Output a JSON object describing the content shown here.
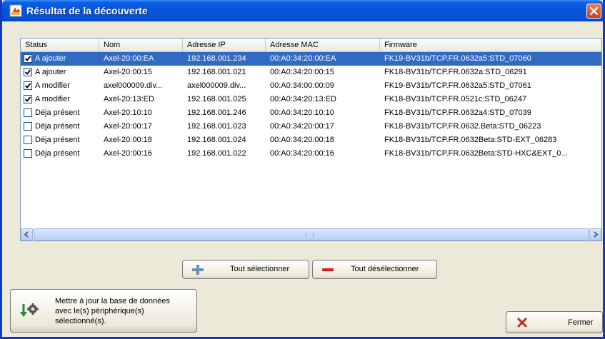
{
  "window": {
    "title": "Résultat de la découverte",
    "close_icon": "close-icon"
  },
  "table": {
    "columns": [
      "Status",
      "Nom",
      "Adresse IP",
      "Adresse MAC",
      "Firmware"
    ],
    "rows": [
      {
        "checked": true,
        "status": "A ajouter",
        "nom": "Axel-20:00:EA",
        "ip": "192.168.001.234",
        "mac": "00:A0:34:20:00:EA",
        "firmware": "FK19-BV31b/TCP.FR.0632a5:STD_07060",
        "selected": true
      },
      {
        "checked": true,
        "status": "A ajouter",
        "nom": "Axel-20:00:15",
        "ip": "192.168.001.021",
        "mac": "00:A0:34:20:00:15",
        "firmware": "FK18-BV31b/TCP.FR.0632a:STD_06291",
        "selected": false
      },
      {
        "checked": true,
        "status": "A modifier",
        "nom": "axel000009.div...",
        "ip": "axel000009.div...",
        "mac": "00:A0:34:00:00:09",
        "firmware": "FK19-BV31b/TCP.FR.0632a5:STD_07061",
        "selected": false
      },
      {
        "checked": true,
        "status": "A modifier",
        "nom": "Axel-20:13:ED",
        "ip": "192.168.001.025",
        "mac": "00:A0:34:20:13:ED",
        "firmware": "FK18-BV31b/TCP.FR.0521c:STD_06247",
        "selected": false
      },
      {
        "checked": false,
        "status": "Déja présent",
        "nom": "Axel-20:10:10",
        "ip": "192.168.001.246",
        "mac": "00:A0:34:20:10:10",
        "firmware": "FK18-BV31b/TCP.FR.0632a4:STD_07039",
        "selected": false
      },
      {
        "checked": false,
        "status": "Déja présent",
        "nom": "Axel-20:00:17",
        "ip": "192.168.001.023",
        "mac": "00:A0:34:20:00:17",
        "firmware": "FK18-BV31b/TCP.FR.0632.Beta:STD_06223",
        "selected": false
      },
      {
        "checked": false,
        "status": "Déja présent",
        "nom": "Axel-20:00:18",
        "ip": "192.168.001.024",
        "mac": "00:A0:34:20:00:18",
        "firmware": "FK18-BV31b/TCP.FR.0632Beta:STD-EXT_06283",
        "selected": false
      },
      {
        "checked": false,
        "status": "Déja présent",
        "nom": "Axel-20:00:16",
        "ip": "192.168.001.022",
        "mac": "00:A0:34:20:00:16",
        "firmware": "FK18-BV31b/TCP.FR.0632Beta:STD-HXC&EXT_0...",
        "selected": false
      }
    ]
  },
  "buttons": {
    "select_all": "Tout sélectionner",
    "deselect_all": "Tout désélectionner",
    "update_db_line1": "Mettre à jour la base de données",
    "update_db_line2": "avec le(s) périphérique(s)",
    "update_db_line3": "sélectionné(s).",
    "close": "Fermer"
  },
  "colors": {
    "titlebar": "#0854d8",
    "selection": "#316ac5",
    "plus_icon": "#6b8fb0",
    "minus_icon": "#d42020",
    "close_x": "#c0281e"
  }
}
